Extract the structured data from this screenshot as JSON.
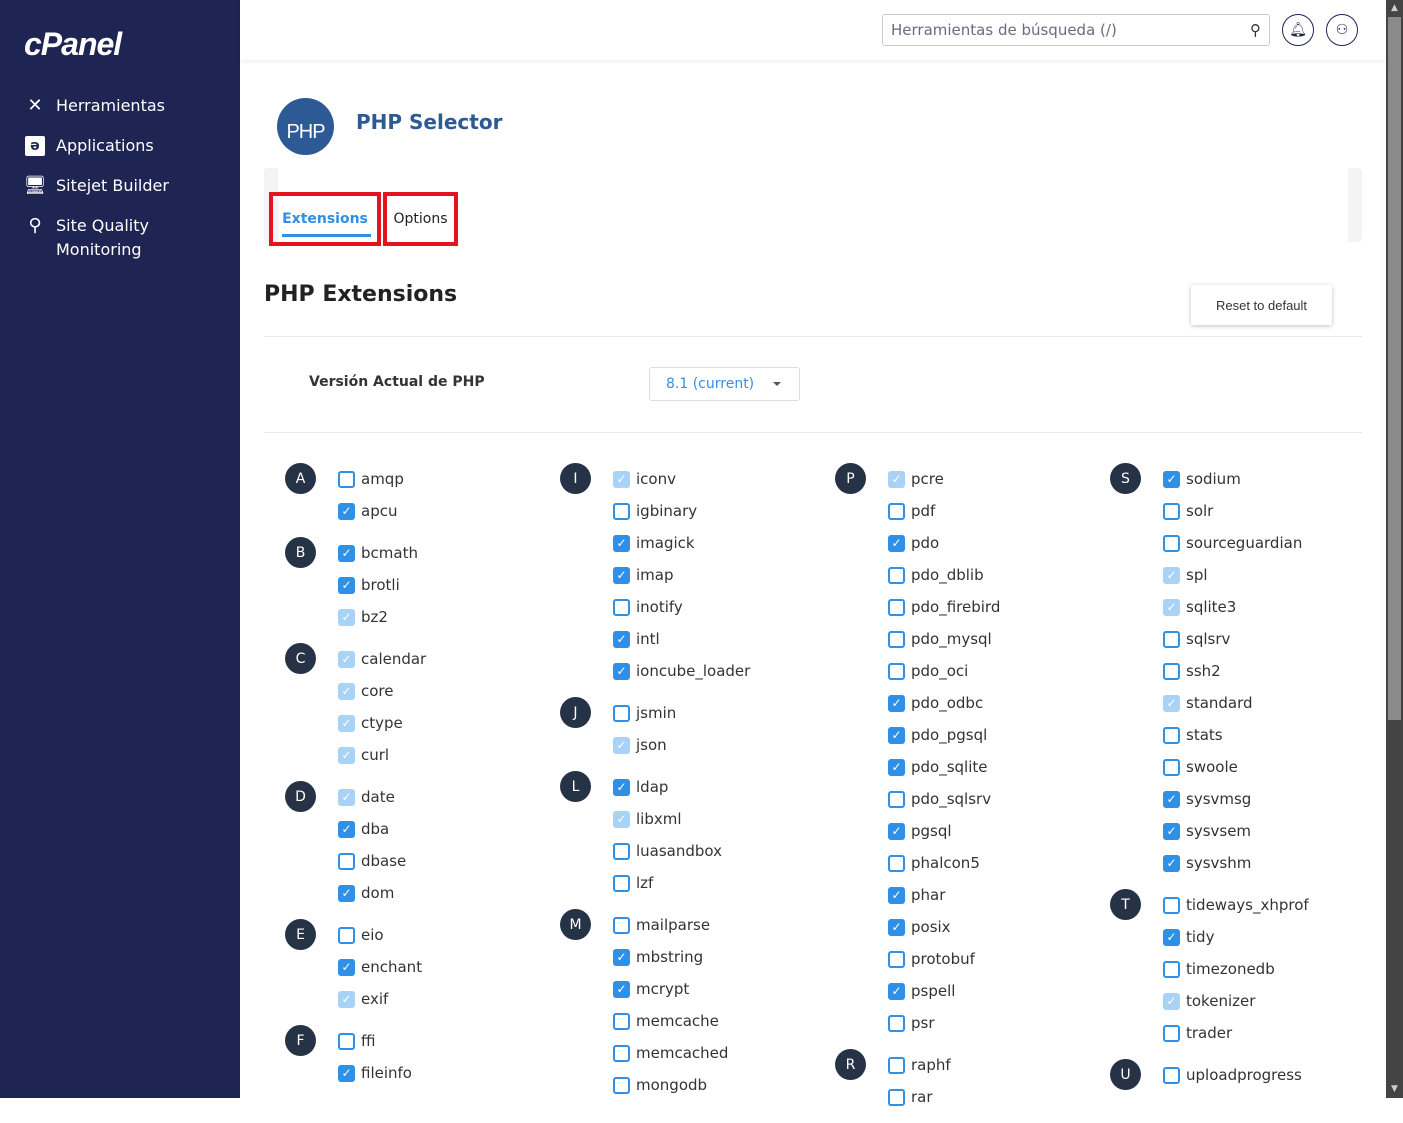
{
  "sidebar": {
    "logo": "cPanel",
    "items": [
      {
        "label": "Herramientas",
        "icon": "tools-icon"
      },
      {
        "label": "Applications",
        "icon": "applications-icon"
      },
      {
        "label": "Sitejet Builder",
        "icon": "sitejet-icon"
      },
      {
        "label": "Site Quality Monitoring",
        "icon": "site-quality-icon"
      }
    ]
  },
  "header": {
    "search_placeholder": "Herramientas de búsqueda (/)"
  },
  "page": {
    "logo_text": "PHP",
    "title": "PHP Selector",
    "tabs": [
      {
        "label": "Extensions",
        "active": true
      },
      {
        "label": "Options",
        "active": false
      }
    ],
    "section_title": "PHP Extensions",
    "reset_label": "Reset to default",
    "version_label": "Versión Actual de PHP",
    "version_value": "8.1 (current)"
  },
  "colors": {
    "sidebar": "#1f2553",
    "accent": "#2e90e6",
    "highlight": "#e3141e"
  },
  "extensions": [
    [
      {
        "letter": "A",
        "items": [
          [
            "amqp",
            "unchecked"
          ],
          [
            "apcu",
            "checked"
          ]
        ]
      },
      {
        "letter": "B",
        "items": [
          [
            "bcmath",
            "checked"
          ],
          [
            "brotli",
            "checked"
          ],
          [
            "bz2",
            "disabled"
          ]
        ]
      },
      {
        "letter": "C",
        "items": [
          [
            "calendar",
            "disabled"
          ],
          [
            "core",
            "disabled"
          ],
          [
            "ctype",
            "disabled"
          ],
          [
            "curl",
            "disabled"
          ]
        ]
      },
      {
        "letter": "D",
        "items": [
          [
            "date",
            "disabled"
          ],
          [
            "dba",
            "checked"
          ],
          [
            "dbase",
            "unchecked"
          ],
          [
            "dom",
            "checked"
          ]
        ]
      },
      {
        "letter": "E",
        "items": [
          [
            "eio",
            "unchecked"
          ],
          [
            "enchant",
            "checked"
          ],
          [
            "exif",
            "disabled"
          ]
        ]
      },
      {
        "letter": "F",
        "items": [
          [
            "ffi",
            "unchecked"
          ],
          [
            "fileinfo",
            "checked"
          ]
        ]
      }
    ],
    [
      {
        "letter": "I",
        "items": [
          [
            "iconv",
            "disabled"
          ],
          [
            "igbinary",
            "unchecked"
          ],
          [
            "imagick",
            "checked"
          ],
          [
            "imap",
            "checked"
          ],
          [
            "inotify",
            "unchecked"
          ],
          [
            "intl",
            "checked"
          ],
          [
            "ioncube_loader",
            "checked"
          ]
        ]
      },
      {
        "letter": "J",
        "items": [
          [
            "jsmin",
            "unchecked"
          ],
          [
            "json",
            "disabled"
          ]
        ]
      },
      {
        "letter": "L",
        "items": [
          [
            "ldap",
            "checked"
          ],
          [
            "libxml",
            "disabled"
          ],
          [
            "luasandbox",
            "unchecked"
          ],
          [
            "lzf",
            "unchecked"
          ]
        ]
      },
      {
        "letter": "M",
        "items": [
          [
            "mailparse",
            "unchecked"
          ],
          [
            "mbstring",
            "checked"
          ],
          [
            "mcrypt",
            "checked"
          ],
          [
            "memcache",
            "unchecked"
          ],
          [
            "memcached",
            "unchecked"
          ],
          [
            "mongodb",
            "unchecked"
          ]
        ]
      }
    ],
    [
      {
        "letter": "P",
        "items": [
          [
            "pcre",
            "disabled"
          ],
          [
            "pdf",
            "unchecked"
          ],
          [
            "pdo",
            "checked"
          ],
          [
            "pdo_dblib",
            "unchecked"
          ],
          [
            "pdo_firebird",
            "unchecked"
          ],
          [
            "pdo_mysql",
            "unchecked"
          ],
          [
            "pdo_oci",
            "unchecked"
          ],
          [
            "pdo_odbc",
            "checked"
          ],
          [
            "pdo_pgsql",
            "checked"
          ],
          [
            "pdo_sqlite",
            "checked"
          ],
          [
            "pdo_sqlsrv",
            "unchecked"
          ],
          [
            "pgsql",
            "checked"
          ],
          [
            "phalcon5",
            "unchecked"
          ],
          [
            "phar",
            "checked"
          ],
          [
            "posix",
            "checked"
          ],
          [
            "protobuf",
            "unchecked"
          ],
          [
            "pspell",
            "checked"
          ],
          [
            "psr",
            "unchecked"
          ]
        ]
      },
      {
        "letter": "R",
        "items": [
          [
            "raphf",
            "unchecked"
          ],
          [
            "rar",
            "unchecked"
          ]
        ]
      }
    ],
    [
      {
        "letter": "S",
        "items": [
          [
            "sodium",
            "checked"
          ],
          [
            "solr",
            "unchecked"
          ],
          [
            "sourceguardian",
            "unchecked"
          ],
          [
            "spl",
            "disabled"
          ],
          [
            "sqlite3",
            "disabled"
          ],
          [
            "sqlsrv",
            "unchecked"
          ],
          [
            "ssh2",
            "unchecked"
          ],
          [
            "standard",
            "disabled"
          ],
          [
            "stats",
            "unchecked"
          ],
          [
            "swoole",
            "unchecked"
          ],
          [
            "sysvmsg",
            "checked"
          ],
          [
            "sysvsem",
            "checked"
          ],
          [
            "sysvshm",
            "checked"
          ]
        ]
      },
      {
        "letter": "T",
        "items": [
          [
            "tideways_xhprof",
            "unchecked"
          ],
          [
            "tidy",
            "checked"
          ],
          [
            "timezonedb",
            "unchecked"
          ],
          [
            "tokenizer",
            "disabled"
          ],
          [
            "trader",
            "unchecked"
          ]
        ]
      },
      {
        "letter": "U",
        "items": [
          [
            "uploadprogress",
            "unchecked"
          ]
        ]
      }
    ]
  ]
}
